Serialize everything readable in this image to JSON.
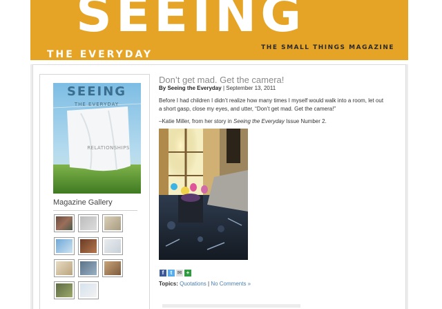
{
  "banner": {
    "title": "SEEING",
    "subtitle": "THE EVERYDAY",
    "tagline": "THE SMALL THINGS MAGAZINE"
  },
  "sidebar": {
    "cover": {
      "title": "SEEING",
      "subtitle": "THE EVERYDAY",
      "theme": "RELATIONSHIPS"
    },
    "gallery_heading": "Magazine Gallery",
    "thumb_count": 11
  },
  "post": {
    "title": "Don’t get mad. Get the camera!",
    "byline_author": "By Seeing the Everyday",
    "byline_sep": " | ",
    "byline_date": "September 13, 2011",
    "paragraph_1": "Before I had children I didn’t realize how many times I myself would walk into a room, let out a short gasp, close my eyes, and utter, “Don’t get mad. Get the camera!”",
    "paragraph_2_prefix": "–Katie Miller, from her story in ",
    "paragraph_2_italic": "Seeing the Everyday",
    "paragraph_2_suffix": " Issue Number 2.",
    "share_icons": [
      "facebook-icon",
      "twitter-icon",
      "email-icon",
      "share-icon"
    ],
    "topics_label": "Topics:",
    "topics_link": "Quotations",
    "topics_sep": " | ",
    "comments_link": "No Comments »"
  },
  "colors": {
    "banner": "#e6a426",
    "link": "#4a7fb0",
    "title_gray": "#8a8a8a"
  }
}
